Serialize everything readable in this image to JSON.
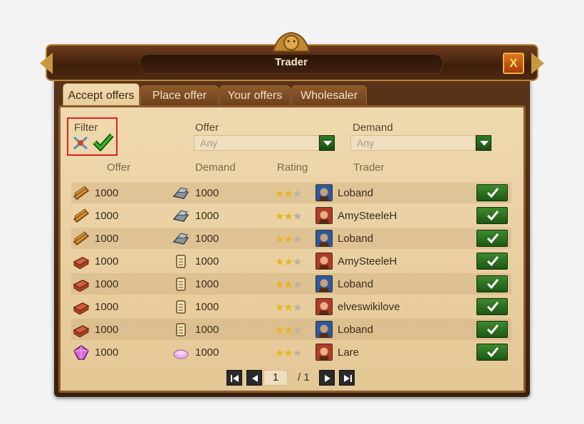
{
  "window": {
    "title": "Trader",
    "close_label": "X"
  },
  "tabs": [
    {
      "label": "Accept offers",
      "active": true
    },
    {
      "label": "Place offer",
      "active": false
    },
    {
      "label": "Your offers",
      "active": false
    },
    {
      "label": "Wholesaler",
      "active": false
    }
  ],
  "filter": {
    "label": "Filter",
    "offer_label": "Offer",
    "offer_value": "Any",
    "demand_label": "Demand",
    "demand_value": "Any"
  },
  "columns": [
    "Offer",
    "Demand",
    "Rating",
    "Trader"
  ],
  "rows": [
    {
      "offer_icon": "planks-icon",
      "offer_amount": "1000",
      "demand_icon": "steel-icon",
      "demand_amount": "1000",
      "rating": 2,
      "trader": "Loband"
    },
    {
      "offer_icon": "planks-icon",
      "offer_amount": "1000",
      "demand_icon": "steel-icon",
      "demand_amount": "1000",
      "rating": 2,
      "trader": "AmySteeleH"
    },
    {
      "offer_icon": "planks-icon",
      "offer_amount": "1000",
      "demand_icon": "steel-icon",
      "demand_amount": "1000",
      "rating": 2,
      "trader": "Loband"
    },
    {
      "offer_icon": "bricks-icon",
      "offer_amount": "1000",
      "demand_icon": "scroll-icon",
      "demand_amount": "1000",
      "rating": 2,
      "trader": "AmySteeleH"
    },
    {
      "offer_icon": "bricks-icon",
      "offer_amount": "1000",
      "demand_icon": "scroll-icon",
      "demand_amount": "1000",
      "rating": 2,
      "trader": "Loband"
    },
    {
      "offer_icon": "bricks-icon",
      "offer_amount": "1000",
      "demand_icon": "scroll-icon",
      "demand_amount": "1000",
      "rating": 2,
      "trader": "elveswikilove"
    },
    {
      "offer_icon": "bricks-icon",
      "offer_amount": "1000",
      "demand_icon": "scroll-icon",
      "demand_amount": "1000",
      "rating": 2,
      "trader": "Loband"
    },
    {
      "offer_icon": "gem-icon",
      "offer_amount": "1000",
      "demand_icon": "silk-icon",
      "demand_amount": "1000",
      "rating": 2,
      "trader": "Lare"
    }
  ],
  "pager": {
    "current": "1",
    "total": "/ 1"
  },
  "colors": {
    "accent_green": "#2f7a24",
    "frame_brown": "#5a3418",
    "panel": "#efd9ae"
  }
}
